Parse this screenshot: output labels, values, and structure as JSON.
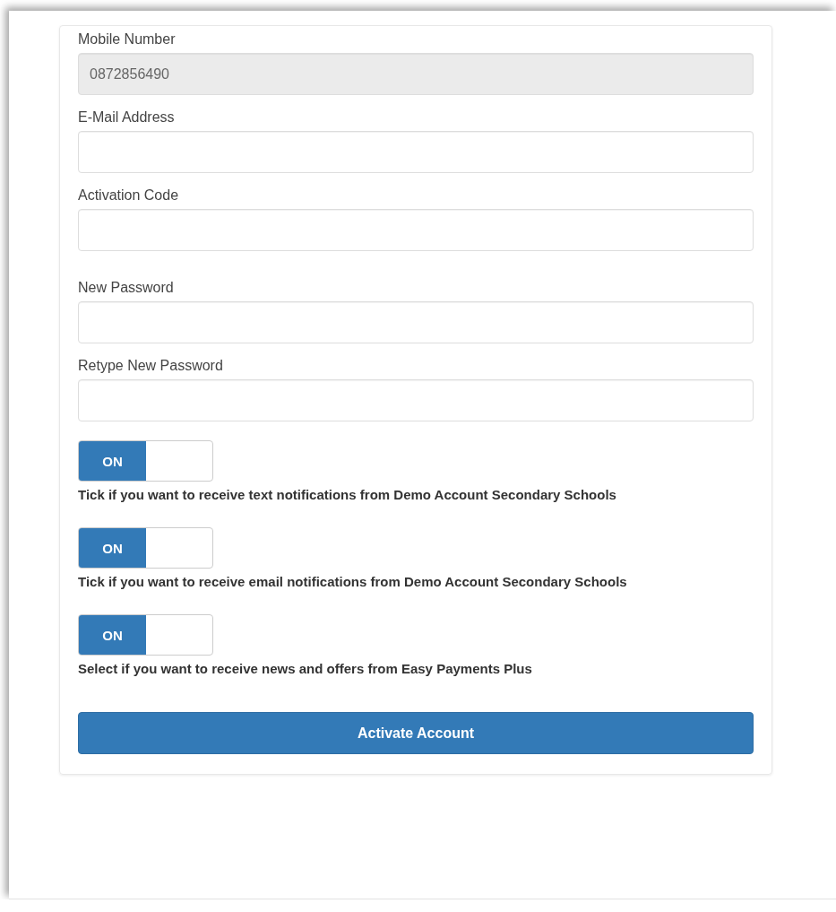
{
  "fields": [
    {
      "label": "Mobile Number",
      "value": "0872856490",
      "disabled": true
    },
    {
      "label": "E-Mail Address",
      "disabled": false
    },
    {
      "label": "Activation Code",
      "disabled": false
    },
    {
      "label": "New Password",
      "disabled": false
    },
    {
      "label": "Retype New Password",
      "disabled": false
    }
  ],
  "toggles": [
    {
      "switch_label": "ON",
      "on": true,
      "text": "Tick if you want to receive text notifications from Demo Account Secondary Schools"
    },
    {
      "switch_label": "ON",
      "on": true,
      "text": "Tick if you want to receive email notifications from Demo Account Secondary Schools"
    },
    {
      "switch_label": "ON",
      "on": true,
      "text": "Select if you want to receive news and offers from Easy Payments Plus"
    }
  ],
  "submit_button": "Activate Account"
}
